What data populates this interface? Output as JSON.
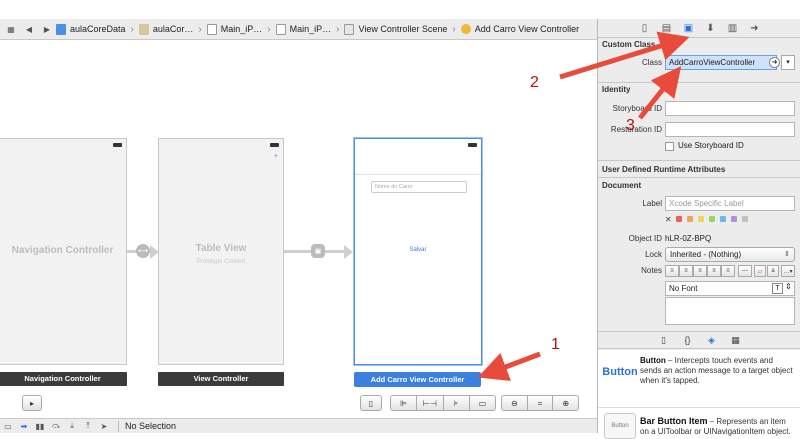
{
  "jumpbar": {
    "crumbs": [
      "aulaCoreData",
      "aulaCor…",
      "Main_iP…",
      "Main_iP…",
      "View Controller Scene",
      "Add Carro View Controller"
    ]
  },
  "canvas": {
    "nav_scene_title": "Navigation Controller",
    "table_scene_title": "Table View",
    "table_scene_subtitle": "Prototype Content",
    "vc_textfield_placeholder": "Nome do Carro",
    "vc_button_text": "Salvar",
    "labels": {
      "nav": "Navigation Controller",
      "table": "View Controller",
      "vc": "Add Carro View Controller"
    }
  },
  "debugbar": {
    "status": "No Selection"
  },
  "inspector": {
    "custom_class": {
      "header": "Custom Class",
      "class_label": "Class",
      "class_value": "AddCarroViewController"
    },
    "identity": {
      "header": "Identity",
      "storyboard_id_label": "Storyboard ID",
      "restoration_id_label": "Restoration ID",
      "use_storyboard_label": "Use Storyboard ID"
    },
    "runtime_attrs": {
      "header": "User Defined Runtime Attributes"
    },
    "document": {
      "header": "Document",
      "label_label": "Label",
      "label_placeholder": "Xcode Specific Label",
      "object_id_label": "Object ID",
      "object_id_value": "hLR-0Z-BPQ",
      "lock_label": "Lock",
      "lock_value": "Inherited - (Nothing)",
      "notes_label": "Notes",
      "font_value": "No Font"
    },
    "label_colors": [
      "#ef5f5f",
      "#f5a35c",
      "#f3d35a",
      "#9ad35d",
      "#6fb5ef",
      "#b58de0",
      "#c0c0c0"
    ]
  },
  "library": {
    "items": [
      {
        "icon": "Button",
        "title": "Button",
        "desc": " – Intercepts touch events and sends an action message to a target object when it's tapped."
      },
      {
        "icon": "Button",
        "title": "Bar Button Item",
        "desc": " – Represents an item on a UIToolbar or UINavigationItem object."
      }
    ]
  },
  "annotations": {
    "one": "1",
    "two": "2",
    "three": "3",
    "color": "#e84b3c"
  }
}
